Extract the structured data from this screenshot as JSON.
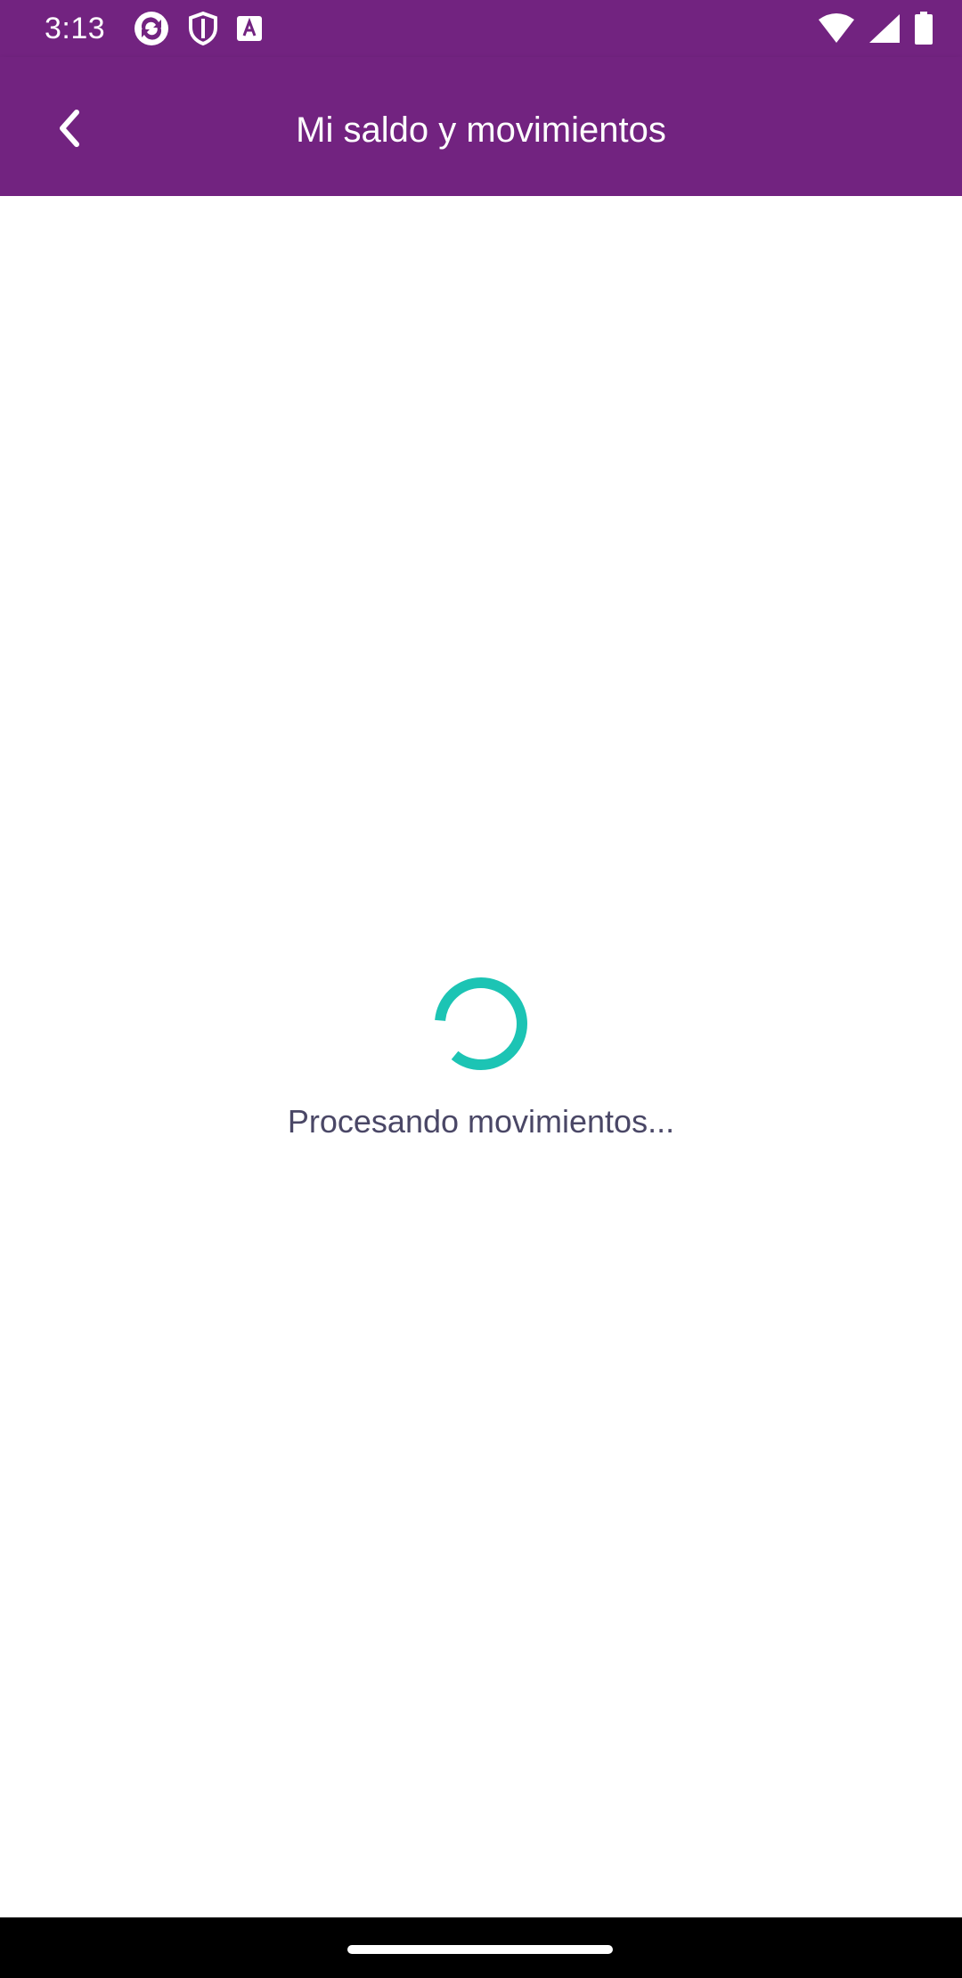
{
  "status_bar": {
    "time": "3:13",
    "left_icons": [
      "sync-app-icon",
      "shield-icon",
      "font-a-icon"
    ],
    "right_icons": [
      "wifi-icon",
      "signal-icon",
      "battery-icon"
    ],
    "background": "#722380"
  },
  "app_bar": {
    "title": "Mi saldo y movimientos",
    "back_icon": "chevron-left-icon",
    "background": "#722380"
  },
  "content": {
    "loading_text": "Procesando movimientos...",
    "spinner_color": "#1cc4b4"
  },
  "nav_bar": {
    "background": "#000000"
  }
}
